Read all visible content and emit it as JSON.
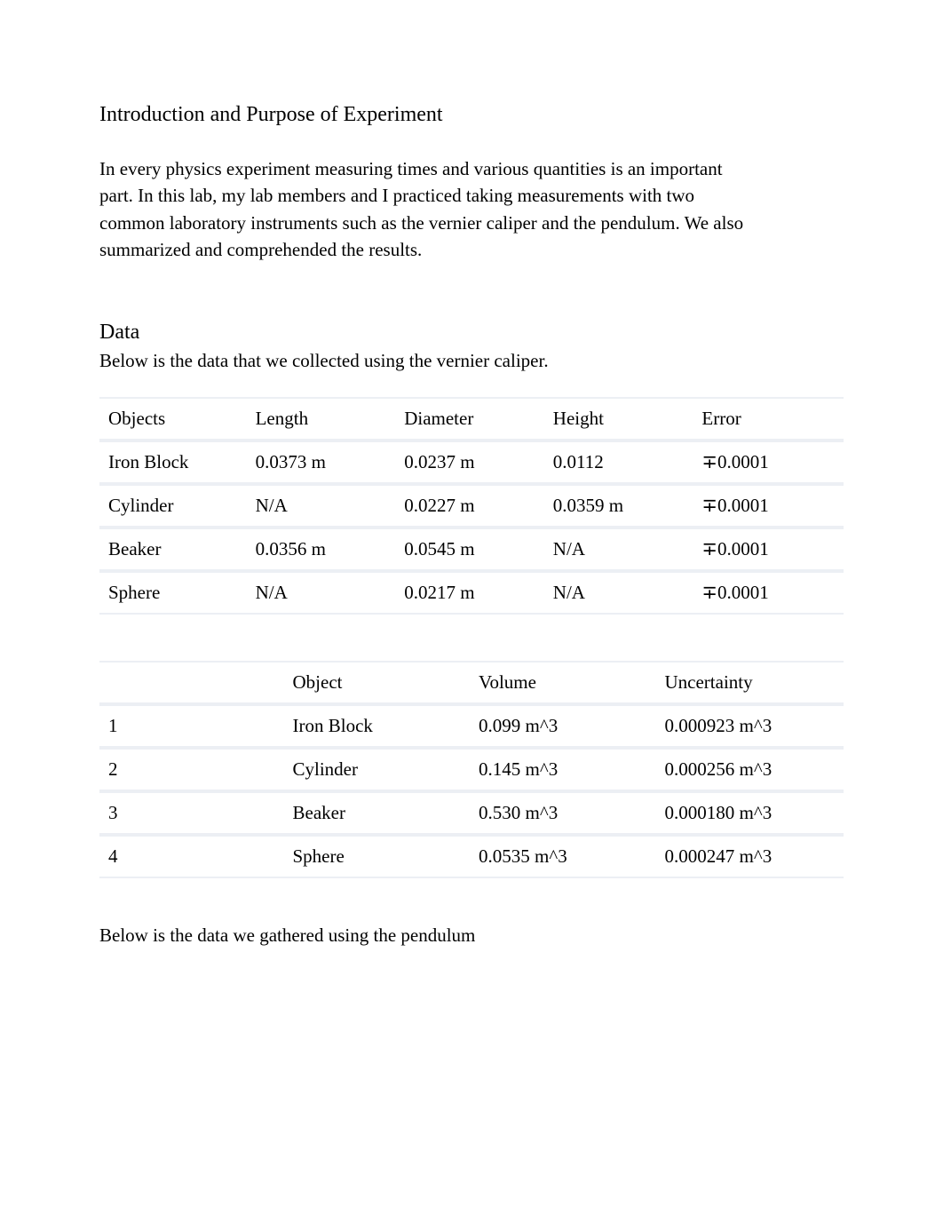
{
  "intro": {
    "heading": "Introduction and Purpose of Experiment",
    "paragraph": "In every physics experiment measuring times and various quantities is an important part. In this lab, my lab members and I practiced taking measurements with two common laboratory instruments such as the vernier caliper and the pendulum. We also summarized and comprehended the results."
  },
  "data_section": {
    "heading": "Data",
    "caption": "Below is the data that we collected using the vernier caliper."
  },
  "table1": {
    "headers": {
      "c0": "Objects",
      "c1": "Length",
      "c2": "Diameter",
      "c3": "Height",
      "c4": "Error"
    },
    "rows": [
      {
        "c0": "Iron Block",
        "c1": "0.0373 m",
        "c2": "0.0237 m",
        "c3": "0.0112",
        "c4": "∓0.0001"
      },
      {
        "c0": "Cylinder",
        "c1": "N/A",
        "c2": "0.0227 m",
        "c3": "0.0359 m",
        "c4": "∓0.0001"
      },
      {
        "c0": "Beaker",
        "c1": "0.0356 m",
        "c2": "0.0545 m",
        "c3": "N/A",
        "c4": "∓0.0001"
      },
      {
        "c0": "Sphere",
        "c1": "N/A",
        "c2": "0.0217 m",
        "c3": "N/A",
        "c4": "∓0.0001"
      }
    ]
  },
  "table2": {
    "headers": {
      "c0": "",
      "c1": "Object",
      "c2": "Volume",
      "c3": "Uncertainty"
    },
    "rows": [
      {
        "c0": "1",
        "c1": "Iron Block",
        "c2": "0.099 m^3",
        "c3": "0.000923 m^3"
      },
      {
        "c0": "2",
        "c1": "Cylinder",
        "c2": "0.145 m^3",
        "c3": "0.000256 m^3"
      },
      {
        "c0": "3",
        "c1": "Beaker",
        "c2": "0.530 m^3",
        "c3": "0.000180 m^3"
      },
      {
        "c0": "4",
        "c1": "Sphere",
        "c2": "0.0535 m^3",
        "c3": "0.000247 m^3"
      }
    ]
  },
  "pendulum_text": "Below is the data we gathered using the pendulum"
}
